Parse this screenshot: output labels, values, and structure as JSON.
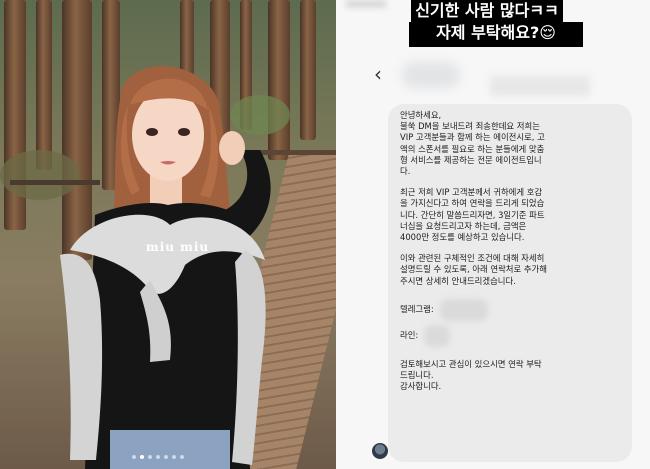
{
  "caption": {
    "line1": "신기한 사람 많다ㅋㅋ",
    "line2": "자제 부탁해요?😌"
  },
  "dm": {
    "back_icon": "chevron-left-icon",
    "message": {
      "greeting": "안녕하세요,",
      "para1": "불쑥 DM을 보내드려 죄송한데요 저희는\nVIP 고객분들과 함께 하는 에이전시로, 고\n액의 스폰서를 필요로 하는 분들에게 맞춤\n형 서비스를 제공하는 전문 에이전트입니\n다.",
      "para2": "최근 저희 VIP 고객분께서 귀하에게 호감\n을 가지신다고 하여 연락을 드리게 되었습\n니다. 간단히 말씀드리자면, 3일기준 파트\n너십을 요청드리고자 하는데, 금액은\n4000만  정도를 예상하고 있습니다.",
      "para3": "이와 관련된 구체적인 조건에 대해 자세히\n설명드릴 수 있도록, 아래 연락처로 추가해\n주시면 상세히 안내드리겠습니다.",
      "telegram_label": "텔레그램:",
      "line_label": "라인:",
      "closing": "검토해보시고 관심이 있으시면 연락 부탁\n드립니다.",
      "thanks": "감사합니다."
    }
  },
  "photo": {
    "shirt_text": "miu miu",
    "carousel_dots": 7,
    "active_dot": 2
  }
}
